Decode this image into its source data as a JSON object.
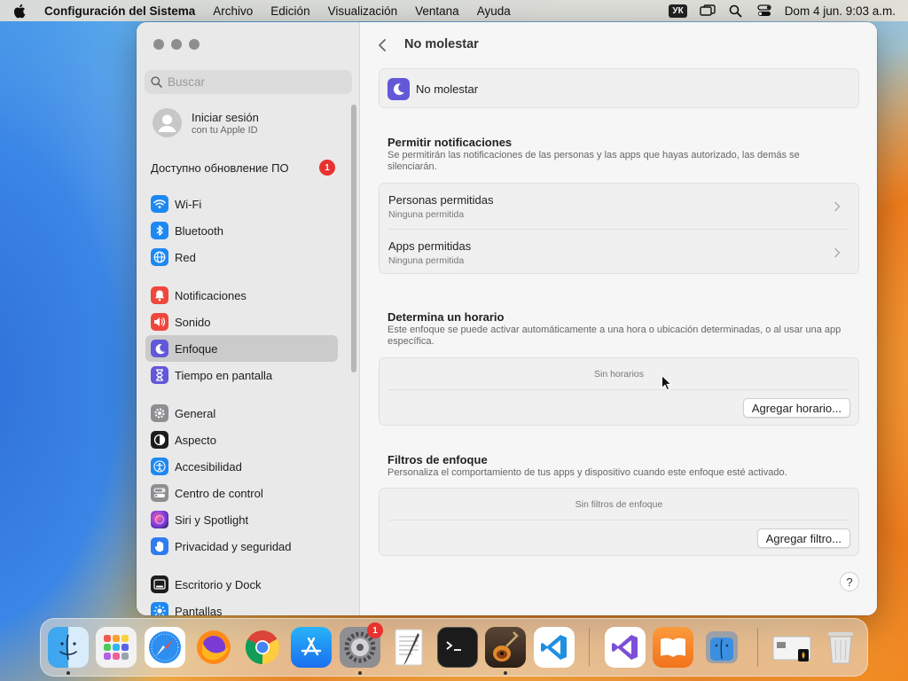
{
  "menubar": {
    "app_name": "Configuración del Sistema",
    "menus": [
      "Archivo",
      "Edición",
      "Visualización",
      "Ventana",
      "Ayuda"
    ],
    "keyboard_layout": "УК",
    "clock": "Dom 4 jun.  9:03 a.m."
  },
  "sidebar": {
    "search_placeholder": "Buscar",
    "account": {
      "title": "Iniciar sesión",
      "subtitle": "con tu Apple ID"
    },
    "update": {
      "label": "Доступно обновление ПО",
      "badge": "1"
    },
    "items": [
      {
        "label": "Wi-Fi",
        "icon": "wifi-icon",
        "color": "#1e88f2"
      },
      {
        "label": "Bluetooth",
        "icon": "bluetooth-icon",
        "color": "#1e88f2"
      },
      {
        "label": "Red",
        "icon": "globe-icon",
        "color": "#1e88f2"
      },
      {
        "label": "Notificaciones",
        "icon": "bell-icon",
        "color": "#f0473d"
      },
      {
        "label": "Sonido",
        "icon": "speaker-icon",
        "color": "#f0473d"
      },
      {
        "label": "Enfoque",
        "icon": "moon-icon",
        "color": "#6258d8"
      },
      {
        "label": "Tiempo en pantalla",
        "icon": "hourglass-icon",
        "color": "#6258d8"
      },
      {
        "label": "General",
        "icon": "gear-icon",
        "color": "#8e8e93"
      },
      {
        "label": "Aspecto",
        "icon": "appearance-icon",
        "color": "#1c1c1e"
      },
      {
        "label": "Accesibilidad",
        "icon": "accessibility-icon",
        "color": "#1e88f2"
      },
      {
        "label": "Centro de control",
        "icon": "control-center-icon",
        "color": "#8e8e93"
      },
      {
        "label": "Siri y Spotlight",
        "icon": "siri-icon",
        "color": "#a13cd6"
      },
      {
        "label": "Privacidad y seguridad",
        "icon": "hand-icon",
        "color": "#2f7cf0"
      },
      {
        "label": "Escritorio y Dock",
        "icon": "desktop-dock-icon",
        "color": "#1c1c1e"
      },
      {
        "label": "Pantallas",
        "icon": "display-icon",
        "color": "#1e88f2"
      }
    ],
    "selected_item": "Enfoque"
  },
  "main": {
    "title": "No molestar",
    "focus_name": "No molestar",
    "allow": {
      "title": "Permitir notificaciones",
      "desc": "Se permitirán las notificaciones de las personas y las apps que hayas autorizado, las demás se silenciarán.",
      "rows": [
        {
          "title": "Personas permitidas",
          "subtitle": "Ninguna permitida"
        },
        {
          "title": "Apps permitidas",
          "subtitle": "Ninguna permitida"
        }
      ]
    },
    "schedule": {
      "title": "Determina un horario",
      "desc": "Este enfoque se puede activar automáticamente a una hora o ubicación determinadas, o al usar una app específica.",
      "empty": "Sin horarios",
      "button": "Agregar horario..."
    },
    "filters": {
      "title": "Filtros de enfoque",
      "desc": "Personaliza el comportamiento de tus apps y dispositivo cuando este enfoque esté activado.",
      "empty": "Sin filtros de enfoque",
      "button": "Agregar filtro..."
    },
    "help": "?"
  },
  "dock": {
    "apps": [
      "Finder",
      "Launchpad",
      "Safari",
      "Firefox",
      "Chrome",
      "App Store",
      "Configuración del Sistema",
      "TextEdit",
      "Terminal",
      "GarageBand",
      "Visual Studio Code",
      "Visual Studio",
      "Libros",
      "Utilidad de Discos"
    ],
    "settings_badge": "1"
  }
}
